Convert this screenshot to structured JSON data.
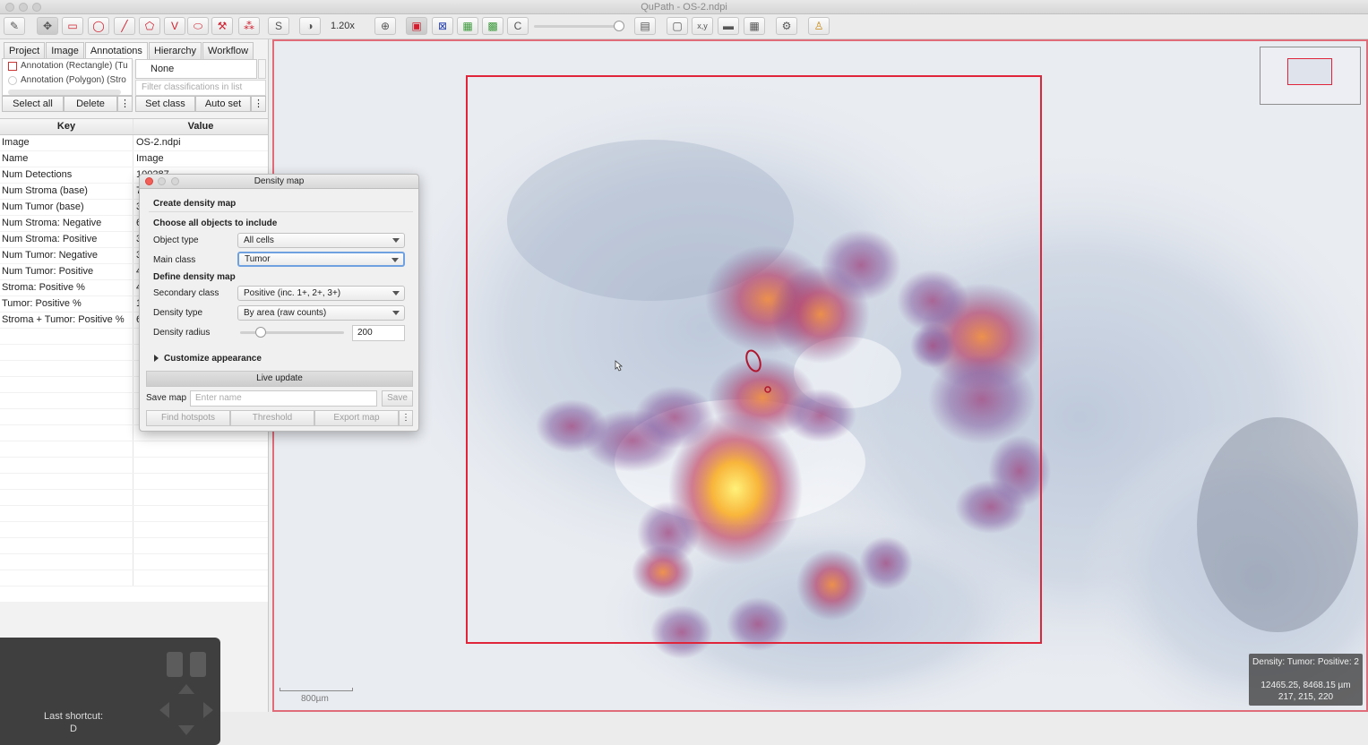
{
  "window": {
    "title": "QuPath - OS-2.ndpi"
  },
  "toolbar": {
    "zoom": "1.20x",
    "buttons": [
      {
        "icon": "gesture-icon",
        "glyph": "✎"
      },
      {
        "icon": "move-icon",
        "glyph": "✥"
      },
      {
        "icon": "rectangle-icon",
        "glyph": "▭"
      },
      {
        "icon": "ellipse-icon",
        "glyph": "◯"
      },
      {
        "icon": "line-icon",
        "glyph": "╱"
      },
      {
        "icon": "polygon-icon",
        "glyph": "⬠"
      },
      {
        "icon": "polyline-icon",
        "glyph": "V"
      },
      {
        "icon": "brush-icon",
        "glyph": "⬭"
      },
      {
        "icon": "wand-icon",
        "glyph": "⚒"
      },
      {
        "icon": "points-icon",
        "glyph": "⁂"
      },
      {
        "icon": "selection-mode-icon",
        "glyph": "S"
      },
      {
        "icon": "contrast-icon",
        "glyph": "◑"
      },
      {
        "icon": "zoom-to-fit-icon",
        "glyph": "⊕"
      },
      {
        "icon": "show-annotations-icon",
        "glyph": "▣"
      },
      {
        "icon": "show-tma-icon",
        "glyph": "⊠"
      },
      {
        "icon": "show-detections-icon",
        "glyph": "▦"
      },
      {
        "icon": "fill-detections-icon",
        "glyph": "▩"
      },
      {
        "icon": "show-connections-icon",
        "glyph": "C"
      },
      {
        "icon": "measurement-table-icon",
        "glyph": "▤"
      },
      {
        "icon": "overview-icon",
        "glyph": "▢"
      },
      {
        "icon": "location-icon",
        "glyph": "x,y"
      },
      {
        "icon": "scalebar-icon",
        "glyph": "▬"
      },
      {
        "icon": "grid-icon",
        "glyph": "▦"
      },
      {
        "icon": "settings-icon",
        "glyph": "⚙"
      },
      {
        "icon": "help-icon",
        "glyph": "♙"
      }
    ]
  },
  "left_panel": {
    "tabs": [
      "Project",
      "Image",
      "Annotations",
      "Hierarchy",
      "Workflow"
    ],
    "active_tab": "Annotations",
    "annotations": [
      "Annotation (Rectangle) (Tu",
      "Annotation (Polygon) (Stro"
    ],
    "class_selected": "None",
    "class_filter_placeholder": "Filter classifications in list",
    "buttons": {
      "select_all": "Select all",
      "delete": "Delete",
      "more": "⋮",
      "set_class": "Set class",
      "auto_set": "Auto set"
    },
    "table_header": {
      "key": "Key",
      "value": "Value"
    },
    "rows": [
      {
        "key": "Image",
        "value": "OS-2.ndpi"
      },
      {
        "key": "Name",
        "value": "Image"
      },
      {
        "key": "Num Detections",
        "value": "100287"
      },
      {
        "key": "Num Stroma (base)",
        "value": "7"
      },
      {
        "key": "Num Tumor (base)",
        "value": "3"
      },
      {
        "key": "Num Stroma: Negative",
        "value": "6"
      },
      {
        "key": "Num Stroma: Positive",
        "value": "3"
      },
      {
        "key": "Num Tumor: Negative",
        "value": "3"
      },
      {
        "key": "Num Tumor: Positive",
        "value": "4"
      },
      {
        "key": "Stroma: Positive %",
        "value": "4"
      },
      {
        "key": "Tumor: Positive %",
        "value": "1"
      },
      {
        "key": "Stroma + Tumor: Positive %",
        "value": "6"
      }
    ]
  },
  "shortcut": {
    "label": "Last shortcut:",
    "key": "D"
  },
  "dialog": {
    "title": "Density map",
    "heading": "Create density map",
    "section_objects": "Choose all objects to include",
    "object_type_label": "Object type",
    "object_type_value": "All cells",
    "main_class_label": "Main class",
    "main_class_value": "Tumor",
    "section_define": "Define density map",
    "secondary_class_label": "Secondary class",
    "secondary_class_value": "Positive (inc. 1+, 2+, 3+)",
    "density_type_label": "Density type",
    "density_type_value": "By area (raw counts)",
    "density_radius_label": "Density radius",
    "density_radius_value": "200",
    "density_radius_slider": 0.2,
    "customize": "Customize appearance",
    "live_update": "Live update",
    "save_map_label": "Save map",
    "save_map_placeholder": "Enter name",
    "save": "Save",
    "find_hotspots": "Find hotspots",
    "threshold": "Threshold",
    "export_map": "Export map",
    "more": "⋮"
  },
  "viewer": {
    "scalebar_label": "800µm",
    "info_density": "Density: Tumor: Positive: 2",
    "info_coords": "12465.25, 8468.15 µm",
    "info_rgb": "217, 215, 220",
    "annotation_color": "#e0243a"
  }
}
